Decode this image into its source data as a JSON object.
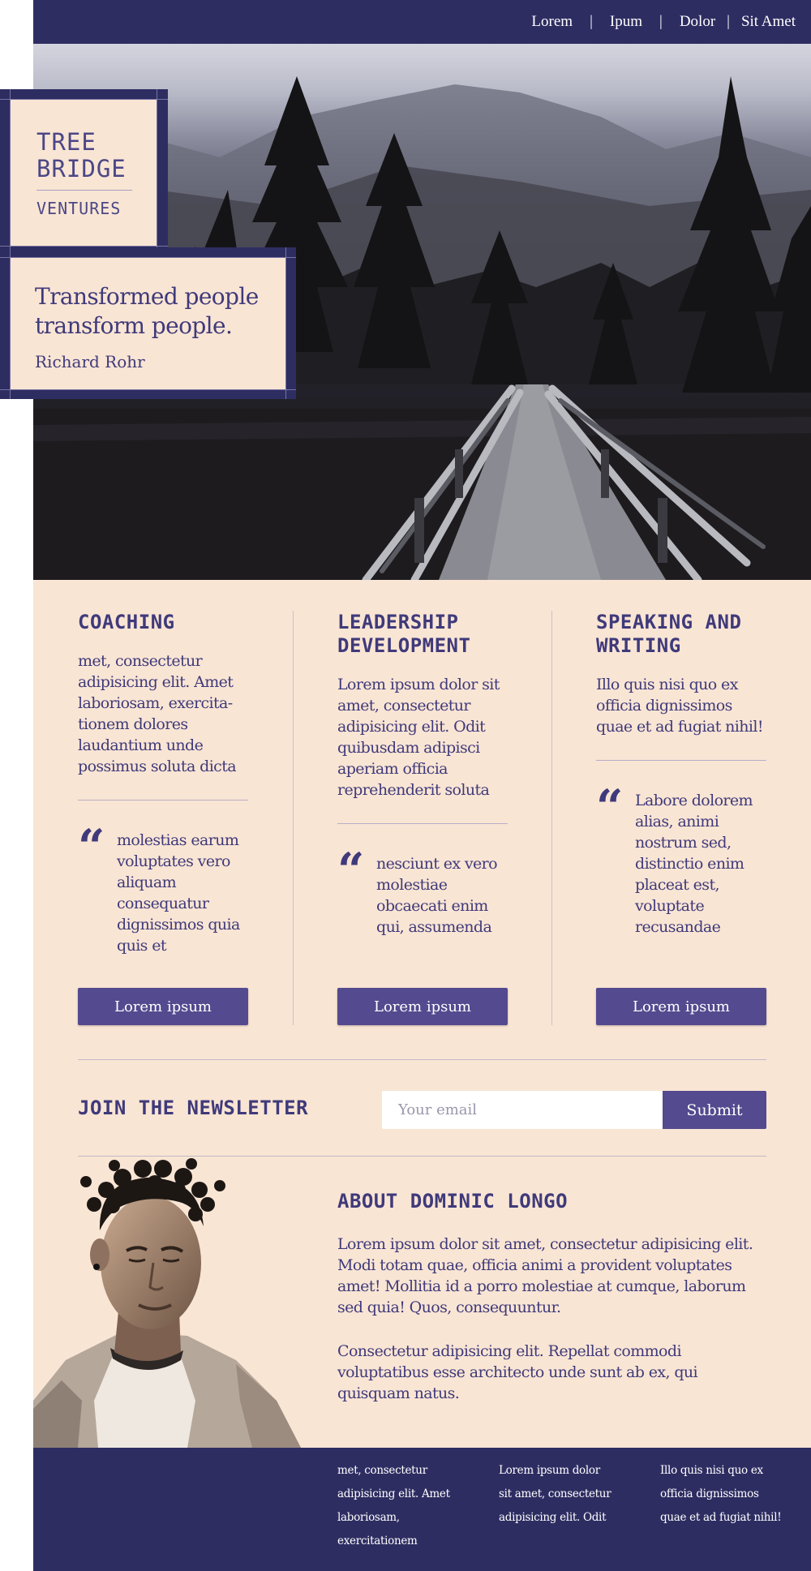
{
  "nav": {
    "items": [
      {
        "label": "Lorem"
      },
      {
        "label": "Ipum"
      },
      {
        "label": "Dolor"
      },
      {
        "label": "Sit Amet"
      }
    ],
    "separator": "|"
  },
  "logo": {
    "line1": "TREE",
    "line2": "BRIDGE",
    "line3": "VENTURES"
  },
  "hero_quote": {
    "text": "Transformed people transform people.",
    "author": "Richard Rohr"
  },
  "services": [
    {
      "title": "COACHING",
      "body": "met, consectetur adipisicing elit. Amet laboriosam, exercita-tionem dolores laudantium unde possimus soluta dicta",
      "quote_mark": "“",
      "quote": "molestias earum voluptates vero aliquam consequatur dignissimos quia quis et",
      "button": "Lorem ipsum"
    },
    {
      "title": "LEADERSHIP DEVELOPMENT",
      "body": "Lorem ipsum dolor sit amet, consectetur adipisicing elit. Odit quibusdam adipisci aperiam officia reprehenderit soluta",
      "quote_mark": "“",
      "quote": "nesciunt ex vero molestiae obcaecati enim qui, assumenda",
      "button": "Lorem ipsum"
    },
    {
      "title": "SPEAKING AND WRITING",
      "body": "Illo quis nisi quo ex officia dignissimos quae et ad fugiat nihil!",
      "quote_mark": "“",
      "quote": "Labore dolorem alias, animi nostrum sed, distinctio enim placeat est, voluptate recusandae",
      "button": "Lorem ipsum"
    }
  ],
  "newsletter": {
    "title": "JOIN THE NEWSLETTER",
    "placeholder": "Your email",
    "submit": "Submit"
  },
  "about": {
    "title": "ABOUT DOMINIC LONGO",
    "p1": "Lorem ipsum dolor sit amet, consectetur adipisicing elit. Modi totam quae, officia animi a provident voluptates amet! Mollitia id a porro molestiae at cumque, laborum sed quia! Quos, consequuntur.",
    "p2": "Consectetur adipisicing elit. Repellat commodi voluptatibus esse architecto unde sunt ab ex, qui quisquam natus."
  },
  "footer": {
    "cols": [
      "met, consectetur adipisicing elit. Amet laboriosam, exercitationem",
      "Lorem ipsum dolor sit amet, consectetur adipisicing elit. Odit",
      "Illo quis nisi quo ex officia dignissimos quae et ad fugiat nihil!"
    ]
  },
  "colors": {
    "navy": "#2e2d62",
    "beige": "#f9e5d4",
    "accent_purple": "#534a8f",
    "text_purple": "#3f3a7a"
  },
  "icons": {
    "quote": "quote-icon"
  }
}
